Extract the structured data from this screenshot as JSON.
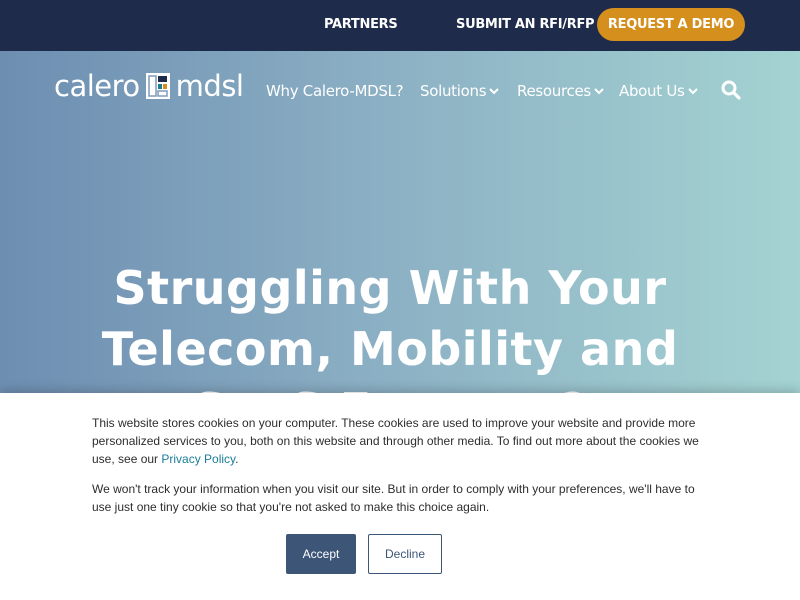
{
  "topbar": {
    "partners_label": "PARTNERS",
    "rfi_label": "SUBMIT AN RFI/RFP",
    "demo_label": "REQUEST A DEMO"
  },
  "logo": {
    "left_text": "calero",
    "right_text": "mdsl"
  },
  "nav": {
    "items": [
      {
        "label": "Why Calero-MDSL?"
      },
      {
        "label": "Solutions",
        "icon": "chevron-down-icon"
      },
      {
        "label": "Resources",
        "icon": "chevron-down-icon"
      },
      {
        "label": "About Us",
        "icon": "chevron-down-icon"
      }
    ],
    "search_icon": "search-icon"
  },
  "hero": {
    "headline_line1": "Struggling With Your",
    "headline_line2": "Telecom, Mobility and",
    "headline_line3": "SaaS Expense?"
  },
  "cookie_banner": {
    "paragraph1_text": "This website stores cookies on your computer. These cookies are used to improve your website and provide more personalized services to you, both on this website and through other media. To find out more about the cookies we use, see our ",
    "privacy_link": "Privacy Policy",
    "paragraph1_end": ".",
    "paragraph2": "We won't track your information when you visit our site. But in order to comply with your preferences, we'll have to use just one tiny cookie so that you're not asked to make this choice again.",
    "accept_label": "Accept",
    "decline_label": "Decline"
  },
  "colors": {
    "topbar_bg": "#1e2b4a",
    "demo_button": "#d48f1c",
    "hero_gradient_start": "#6d8eb1",
    "hero_gradient_end": "#a4d3d2",
    "accept_button": "#3d5577",
    "link": "#1a7d98"
  }
}
